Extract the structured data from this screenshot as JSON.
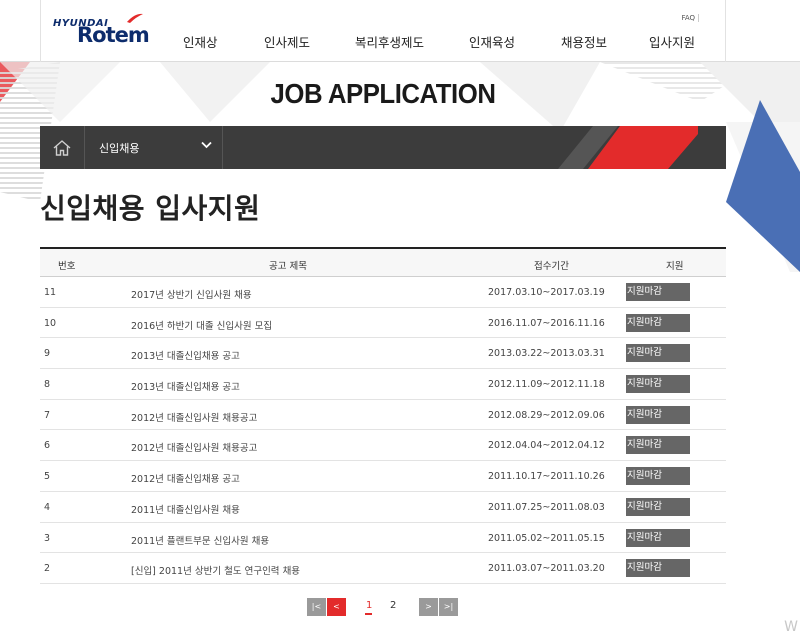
{
  "brand": {
    "line1": "HYUNDAI",
    "line2": "Rotem"
  },
  "header": {
    "nav": [
      "인재상",
      "인사제도",
      "복리후생제도",
      "인재육성",
      "채용정보",
      "입사지원"
    ],
    "faq": "FAQ"
  },
  "banner": {
    "title": "JOB APPLICATION"
  },
  "breadcrumb": {
    "current": "신입채용"
  },
  "page": {
    "title": "신입채용 입사지원"
  },
  "table": {
    "headers": {
      "no": "번호",
      "title": "공고 제목",
      "period": "접수기간",
      "apply": "지원"
    },
    "rows": [
      {
        "no": "11",
        "title": "2017년 상반기 신입사원 채용",
        "period": "2017.03.10~2017.03.19",
        "status": "지원마감"
      },
      {
        "no": "10",
        "title": "2016년 하반기 대졸 신입사원 모집",
        "period": "2016.11.07~2016.11.16",
        "status": "지원마감"
      },
      {
        "no": "9",
        "title": "2013년 대졸신입채용 공고",
        "period": "2013.03.22~2013.03.31",
        "status": "지원마감"
      },
      {
        "no": "8",
        "title": "2013년 대졸신입채용 공고",
        "period": "2012.11.09~2012.11.18",
        "status": "지원마감"
      },
      {
        "no": "7",
        "title": "2012년 대졸신입사원 채용공고",
        "period": "2012.08.29~2012.09.06",
        "status": "지원마감"
      },
      {
        "no": "6",
        "title": "2012년 대졸신입사원 채용공고",
        "period": "2012.04.04~2012.04.12",
        "status": "지원마감"
      },
      {
        "no": "5",
        "title": "2012년 대졸신입채용 공고",
        "period": "2011.10.17~2011.10.26",
        "status": "지원마감"
      },
      {
        "no": "4",
        "title": "2011년 대졸신입사원 채용",
        "period": "2011.07.25~2011.08.03",
        "status": "지원마감"
      },
      {
        "no": "3",
        "title": "2011년 플랜트부문 신입사원 채용",
        "period": "2011.05.02~2011.05.15",
        "status": "지원마감"
      },
      {
        "no": "2",
        "title": "[신입] 2011년 상반기 철도 연구인력 채용",
        "period": "2011.03.07~2011.03.20",
        "status": "지원마감"
      }
    ]
  },
  "pagination": {
    "first": "|<",
    "prev": "<",
    "pages": [
      "1",
      "2"
    ],
    "current": "1",
    "next": ">",
    "last": ">|"
  },
  "watermark": "W",
  "colors": {
    "accent": "#e32b2b",
    "navy": "#0d2c6c",
    "bar": "#3c3c3c",
    "blue": "#4a6fb5"
  }
}
